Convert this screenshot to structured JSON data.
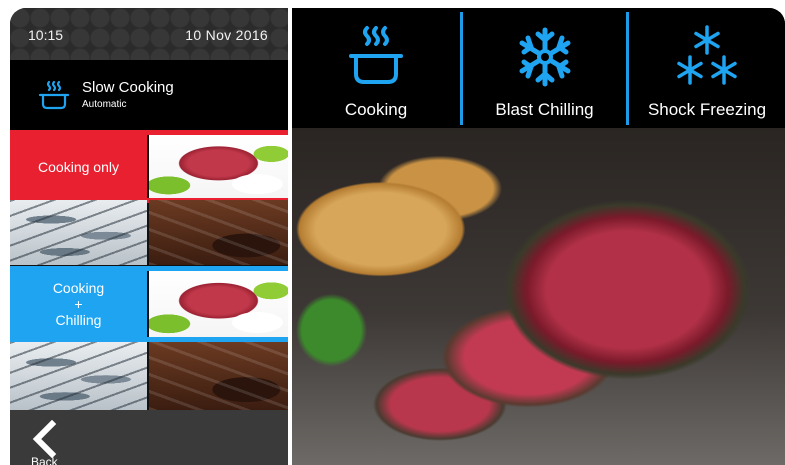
{
  "status_bar": {
    "time": "10:15",
    "date": "10 Nov 2016"
  },
  "mode": {
    "title": "Slow Cooking",
    "subtitle": "Automatic",
    "icon": "pot-steam-icon"
  },
  "programs": [
    {
      "label": "Cooking only",
      "color": "#e8202f",
      "images": [
        "meat",
        "fish",
        "chocolate"
      ]
    },
    {
      "label_lines": [
        "Cooking",
        "+",
        "Chilling"
      ],
      "color": "#1ea4f0",
      "images": [
        "meat",
        "fish",
        "chocolate"
      ]
    }
  ],
  "back": {
    "label": "Back",
    "icon": "chevron-left-icon"
  },
  "functions": [
    {
      "label": "Cooking",
      "icon": "pot-steam-icon"
    },
    {
      "label": "Blast Chilling",
      "icon": "snowflake-icon"
    },
    {
      "label": "Shock Freezing",
      "icon": "snowflakes-icon"
    }
  ],
  "colors": {
    "accent_blue": "#1ea4f0",
    "accent_red": "#e8202f",
    "panel": "#000000"
  }
}
